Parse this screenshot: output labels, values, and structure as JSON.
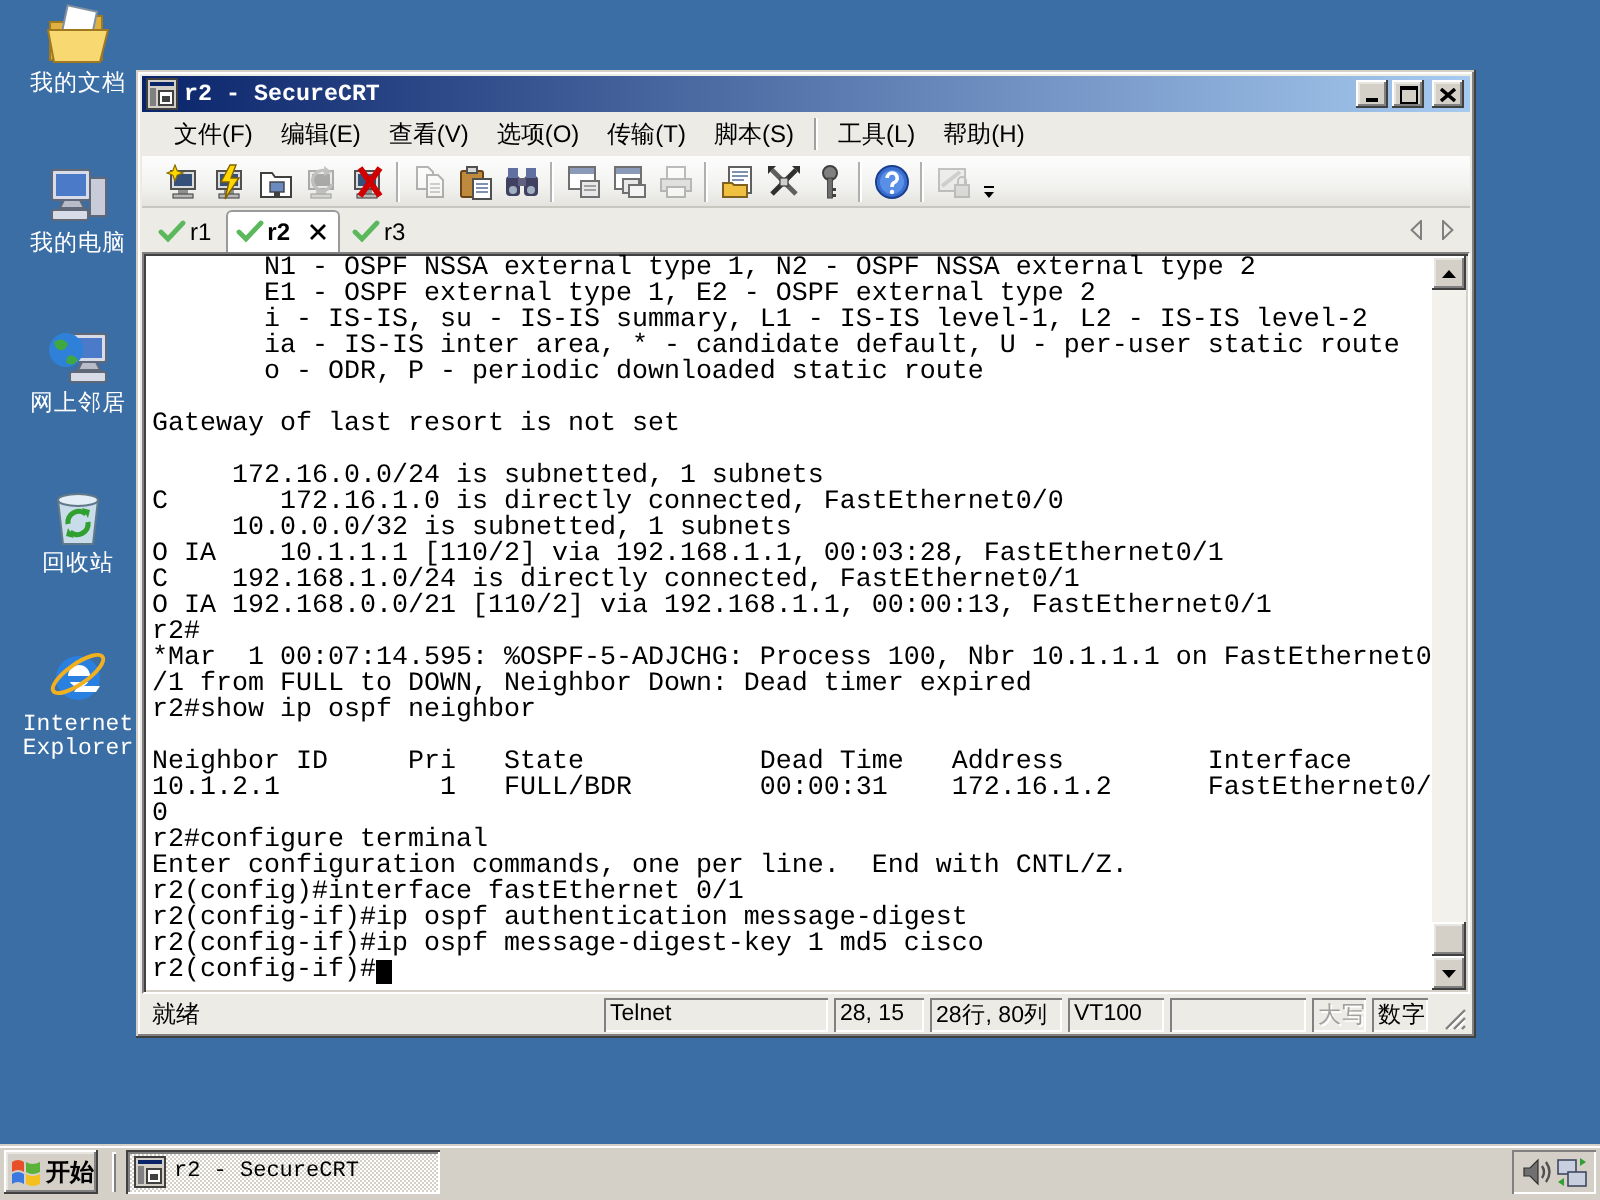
{
  "desktop": {
    "icons": [
      {
        "label": "我的文档"
      },
      {
        "label": "我的电脑"
      },
      {
        "label": "网上邻居"
      },
      {
        "label": "回收站"
      },
      {
        "label": "Internet Explorer"
      }
    ]
  },
  "window": {
    "title": "r2 - SecureCRT"
  },
  "menu": [
    [
      "文件(F)",
      "编辑(E)",
      "查看(V)",
      "选项(O)",
      "传输(T)",
      "脚本(S)"
    ],
    [
      "工具(L)",
      "帮助(H)"
    ]
  ],
  "toolbar": [
    [
      {
        "disabled": false
      },
      {
        "disabled": false
      },
      {
        "disabled": false
      },
      {
        "disabled": true
      },
      {
        "disabled": false
      }
    ],
    [
      {
        "disabled": true
      },
      {
        "disabled": false
      },
      {
        "disabled": false
      }
    ],
    [
      {
        "disabled": false
      },
      {
        "disabled": false
      },
      {
        "disabled": true
      }
    ],
    [
      {
        "disabled": false
      },
      {
        "disabled": false
      },
      {
        "disabled": false
      }
    ],
    [
      {
        "disabled": false
      }
    ],
    [
      {
        "disabled": true
      }
    ]
  ],
  "tabs": [
    {
      "label": "r1",
      "selected": false,
      "connected": true
    },
    {
      "label": "r2",
      "selected": true,
      "connected": true
    },
    {
      "label": "r3",
      "selected": false,
      "connected": true
    }
  ],
  "terminal": {
    "blocks": [
      [
        "       N1 - OSPF NSSA external type 1, N2 - OSPF NSSA external type 2",
        "       E1 - OSPF external type 1, E2 - OSPF external type 2",
        "       i - IS-IS, su - IS-IS summary, L1 - IS-IS level-1, L2 - IS-IS level-2",
        "       ia - IS-IS inter area, * - candidate default, U - per-user static route",
        "       o - ODR, P - periodic downloaded static route"
      ],
      [
        "Gateway of last resort is not set"
      ],
      [
        "     172.16.0.0/24 is subnetted, 1 subnets",
        "C       172.16.1.0 is directly connected, FastEthernet0/0",
        "     10.0.0.0/32 is subnetted, 1 subnets",
        "O IA    10.1.1.1 [110/2] via 192.168.1.1, 00:03:28, FastEthernet0/1",
        "C    192.168.1.0/24 is directly connected, FastEthernet0/1",
        "O IA 192.168.0.0/21 [110/2] via 192.168.1.1, 00:00:13, FastEthernet0/1",
        "r2#",
        "*Mar  1 00:07:14.595: %OSPF-5-ADJCHG: Process 100, Nbr 10.1.1.1 on FastEthernet0",
        "/1 from FULL to DOWN, Neighbor Down: Dead timer expired",
        "r2#show ip ospf neighbor"
      ],
      [
        "Neighbor ID     Pri   State           Dead Time   Address         Interface",
        "10.1.2.1          1   FULL/BDR        00:00:31    172.16.1.2      FastEthernet0/",
        "0",
        "r2#configure terminal",
        "Enter configuration commands, one per line.  End with CNTL/Z.",
        "r2(config)#interface fastEthernet 0/1",
        "r2(config-if)#ip ospf authentication message-digest",
        "r2(config-if)#ip ospf message-digest-key 1 md5 cisco",
        "r2(config-if)#"
      ]
    ],
    "cursor": true
  },
  "status_bar": {
    "message": "就绪",
    "panes": [
      {
        "kind": "text",
        "text": "Telnet"
      },
      {
        "kind": "text",
        "text": "28, 15"
      },
      {
        "kind": "text",
        "text": "28行, 80列"
      },
      {
        "kind": "text",
        "text": "VT100"
      },
      {
        "kind": "blank"
      },
      {
        "kind": "indicator",
        "text": "大写",
        "on": false
      },
      {
        "kind": "indicator",
        "text": "数字",
        "on": true
      }
    ]
  },
  "taskbar": {
    "start": "开始",
    "tasks": [
      {
        "label": "r2 - SecureCRT",
        "selected": true
      }
    ]
  }
}
